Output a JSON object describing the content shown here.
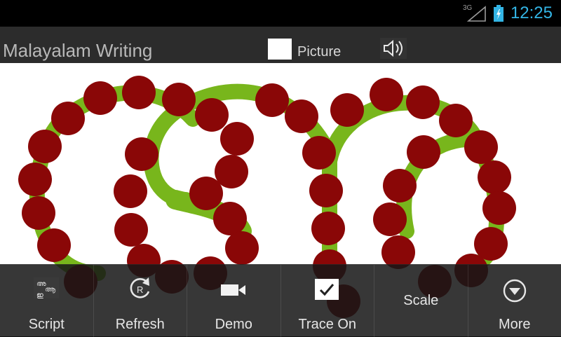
{
  "status_bar": {
    "network": "3G",
    "time": "12:25",
    "accent_color": "#33b5e5"
  },
  "action_bar": {
    "title": "Malayalam Writing",
    "picture_label": "Picture",
    "picture_checked": false,
    "speaker_icon": "speaker-icon"
  },
  "canvas": {
    "stroke_color": "#78b61c",
    "dot_color": "#8a0707"
  },
  "toolbar": {
    "items": [
      {
        "label": "Script",
        "icon": "script-icon"
      },
      {
        "label": "Refresh",
        "icon": "refresh-icon"
      },
      {
        "label": "Demo",
        "icon": "video-camera-icon"
      },
      {
        "label": "Trace On",
        "icon": "checkbox-icon",
        "checked": true
      },
      {
        "label": "Scale",
        "icon": ""
      },
      {
        "label": "More",
        "icon": "chevron-down-circle-icon"
      }
    ]
  }
}
